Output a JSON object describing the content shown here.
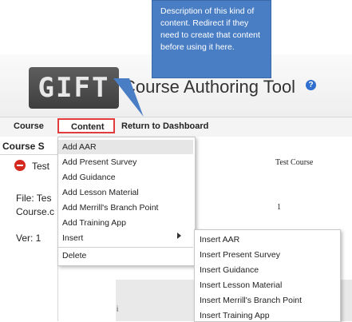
{
  "header": {
    "logo_text": "GIFT",
    "app_title": "Course Authoring Tool",
    "help_icon": "?"
  },
  "menubar": {
    "course": "Course",
    "content": "Content",
    "return": "Return to Dashboard"
  },
  "left_panel": {
    "section_title": "Course S",
    "item_label": "Test",
    "file_label": "File: Tes",
    "file_value": "Course.c",
    "ver_label": "Ver: 1"
  },
  "main": {
    "course_name": "Test Course",
    "value_2": "1",
    "mark": "i"
  },
  "dropdown": {
    "items": [
      "Add AAR",
      "Add Present Survey",
      "Add Guidance",
      "Add Lesson Material",
      "Add Merrill's Branch Point",
      "Add Training App",
      "Insert",
      "Delete"
    ]
  },
  "submenu": {
    "items": [
      "Insert AAR",
      "Insert Present Survey",
      "Insert Guidance",
      "Insert Lesson Material",
      "Insert Merrill's Branch Point",
      "Insert Training App"
    ]
  },
  "callout": {
    "text": "Description of this kind of content. Redirect if they need to create that content before using it here."
  },
  "colors": {
    "highlight_border": "#e23b3b",
    "callout_bg": "#4a7ec4",
    "remove_icon": "#d4291e",
    "help_icon": "#2f6fd0"
  }
}
